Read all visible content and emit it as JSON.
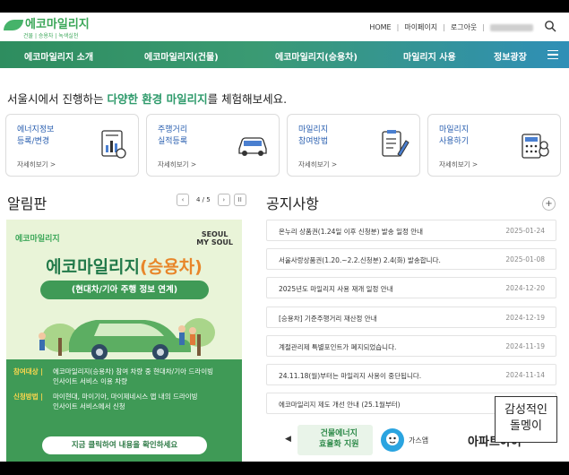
{
  "header": {
    "logo": "에코마일리지",
    "logo_sub": "건물 | 승용차 | 녹색실천",
    "links": [
      "HOME",
      "마이페이지",
      "로그아웃"
    ]
  },
  "nav": {
    "items": [
      "에코마일리지 소개",
      "에코마일리지(건물)",
      "에코마일리지(승용차)",
      "마일리지 사용",
      "정보광장"
    ]
  },
  "intro": {
    "before": "서울시에서 진행하는 ",
    "highlight": "다양한 환경 마일리지",
    "after": "를 체험해보세요."
  },
  "cards": [
    {
      "title": "에너지정보\n등록/변경",
      "more": "자세히보기 >",
      "icon": "chart-document-icon"
    },
    {
      "title": "주행거리\n실적등록",
      "more": "자세히보기 >",
      "icon": "car-icon"
    },
    {
      "title": "마일리지\n참여방법",
      "more": "자세히보기 >",
      "icon": "checklist-pencil-icon"
    },
    {
      "title": "마일리지\n사용하기",
      "more": "자세히보기 >",
      "icon": "calculator-coin-icon"
    }
  ],
  "board": {
    "title": "알림판",
    "pager": "4 / 5",
    "banner": {
      "logo": "에코마일리지",
      "seoul": "SEOUL\nMY SOUL",
      "title_a": "에코마일리지",
      "title_b": "(승용차)",
      "pill": "(현대차/기아 주행 정보 연계)",
      "row1_key": "참여대상 |",
      "row1_val": "에코마일리지(승용차) 참여 차량 중 현대차/기아 드라이빙\n인사이트 서비스 이용 차량",
      "row2_key": "신청방법 |",
      "row2_val": "마이현대, 마이기아, 마이제네시스 앱 내의 드라이빙\n인사이트 서비스에서 신청",
      "cta": "지금 클릭하여 내용을 확인하세요"
    }
  },
  "notices": {
    "title": "공지사항",
    "items": [
      {
        "text": "온누리 상품권(1.24일 이후 신청분) 발송 일정 안내",
        "date": "2025-01-24"
      },
      {
        "text": "서울사랑상품권(1.20.~2.2.신청분) 2.4(화) 발송합니다.",
        "date": "2025-01-08"
      },
      {
        "text": "2025년도 마일리지 사용 재개 일정 안내",
        "date": "2024-12-20"
      },
      {
        "text": "[승용차] 기준주행거리 재산정 안내",
        "date": "2024-12-19"
      },
      {
        "text": "계절관리제 특별포인트가 폐지되었습니다.",
        "date": "2024-11-19"
      },
      {
        "text": "24.11.18(월)부터는 마일리지 사용이 중단됩니다.",
        "date": "2024-11-14"
      },
      {
        "text": "에코마일리지 제도 개선 안내 (25.1월부터)",
        "date": ""
      }
    ]
  },
  "partners": {
    "prev": "◀",
    "logo1": "건물에너지\n효율화 지원",
    "logo2": "가스앱",
    "logo3": "아파트아이"
  },
  "watermark": "감성적인\n돌멩이",
  "colors": {
    "brand_green": "#3aa657",
    "card_title_blue": "#2a5fb0",
    "nav_start": "#2e8d5f",
    "nav_end": "#2f8fb7"
  }
}
